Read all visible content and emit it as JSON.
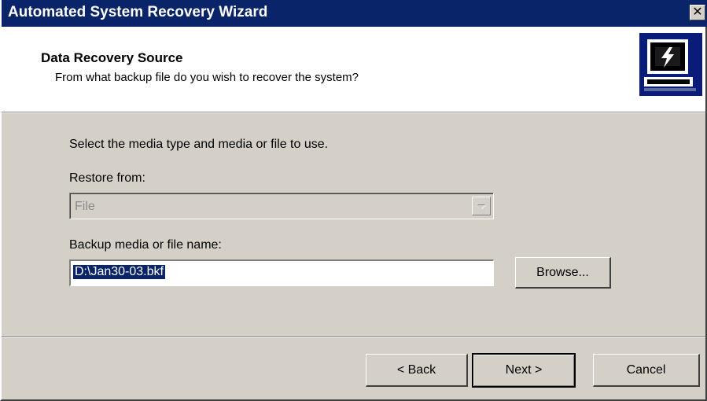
{
  "window": {
    "title": "Automated System Recovery Wizard",
    "close_glyph": "✕"
  },
  "header": {
    "title": "Data Recovery Source",
    "subtitle": "From what backup file do you wish to recover the system?"
  },
  "body": {
    "instruction": "Select the media type and media or file to use.",
    "restore_from_label": "Restore from:",
    "restore_from_value": "File",
    "restore_from_disabled": true,
    "backup_label": "Backup media or file name:",
    "backup_value": "D:\\Jan30-03.bkf"
  },
  "buttons": {
    "browse": "Browse...",
    "back": "< Back",
    "next": "Next >",
    "cancel": "Cancel"
  },
  "icons": {
    "titlebar_close": "close-icon",
    "header": "computer-recovery-icon",
    "dropdown": "chevron-down-icon"
  },
  "colors": {
    "titlebar": "#0a246a",
    "dialog_face": "#d4d0c8",
    "selection": "#0a246a"
  }
}
